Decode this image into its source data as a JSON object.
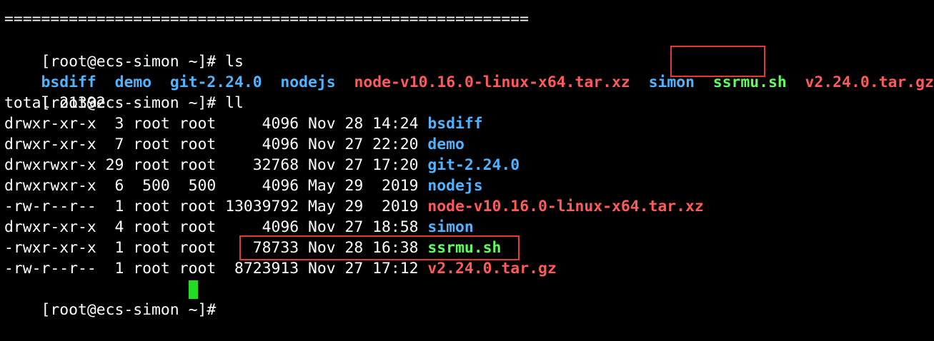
{
  "terminal": {
    "separator": "=========================================================",
    "prompt": "[root@ecs-simon ~]# ",
    "commands": {
      "ls": "ls",
      "ll": "ll"
    },
    "ls_output": [
      {
        "name": "bsdiff",
        "type": "dir"
      },
      {
        "name": "demo",
        "type": "dir"
      },
      {
        "name": "git-2.24.0",
        "type": "dir"
      },
      {
        "name": "nodejs",
        "type": "dir"
      },
      {
        "name": "node-v10.16.0-linux-x64.tar.xz",
        "type": "archive"
      },
      {
        "name": "simon",
        "type": "dir"
      },
      {
        "name": "ssrmu.sh",
        "type": "exec"
      },
      {
        "name": "v2.24.0.tar.gz",
        "type": "archive"
      }
    ],
    "total_line": "total 21392",
    "ll_rows": [
      {
        "meta": "drwxr-xr-x  3 root root     4096 Nov 28 14:24 ",
        "name": "bsdiff",
        "type": "dir"
      },
      {
        "meta": "drwxr-xr-x  7 root root     4096 Nov 27 22:20 ",
        "name": "demo",
        "type": "dir"
      },
      {
        "meta": "drwxrwxr-x 29 root root    32768 Nov 27 17:20 ",
        "name": "git-2.24.0",
        "type": "dir"
      },
      {
        "meta": "drwxrwxr-x  6  500  500     4096 May 29  2019 ",
        "name": "nodejs",
        "type": "dir"
      },
      {
        "meta": "-rw-r--r--  1 root root 13039792 May 29  2019 ",
        "name": "node-v10.16.0-linux-x64.tar.xz",
        "type": "archive"
      },
      {
        "meta": "drwxr-xr-x  4 root root     4096 Nov 27 18:58 ",
        "name": "simon",
        "type": "dir"
      },
      {
        "meta": "-rwxr-xr-x  1 root root    78733 Nov 28 16:38 ",
        "name": "ssrmu.sh",
        "type": "exec"
      },
      {
        "meta": "-rw-r--r--  1 root root  8723913 Nov 27 17:12 ",
        "name": "v2.24.0.tar.gz",
        "type": "archive"
      }
    ],
    "colors": {
      "background": "#000000",
      "text": "#ffffff",
      "dir": "#4fb3ff",
      "archive": "#ff5a5a",
      "exec": "#5cff5c",
      "highlight": "#e53935",
      "cursor": "#22dd22"
    }
  }
}
